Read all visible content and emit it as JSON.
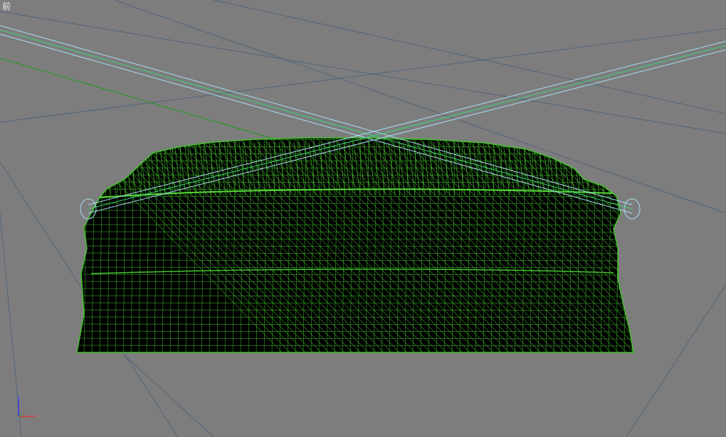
{
  "viewport": {
    "label": "前",
    "background": "#7d7d7d",
    "grid_color": "#50657a",
    "world_axis_color": "#1d9a1d",
    "mesh_color": "#43c22c",
    "mesh_fill": "#000000",
    "cable_color": "#a8dcf0",
    "cable_core_color": "#3fd07a"
  },
  "axis_gizmo": {
    "z_label": "z",
    "x_label": "x",
    "z_color": "#3a3ad8",
    "x_color": "#d83a3a"
  },
  "objects": [
    {
      "name": "cloth-mesh",
      "type": "wireframe-mesh"
    },
    {
      "name": "cable-left",
      "type": "cylinder"
    },
    {
      "name": "cable-right",
      "type": "cylinder"
    }
  ]
}
